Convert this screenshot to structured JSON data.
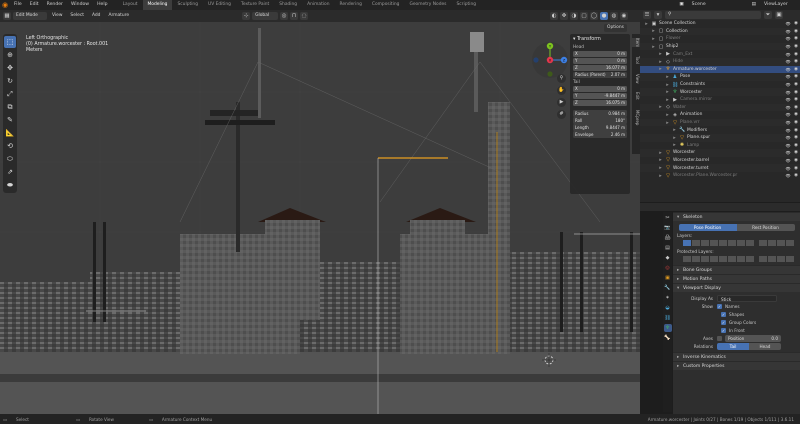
{
  "menubar": {
    "app_logo_icon": "blender-logo-icon",
    "menus": [
      "File",
      "Edit",
      "Render",
      "Window",
      "Help"
    ],
    "workspaces": [
      "Layout",
      "Modeling",
      "Sculpting",
      "UV Editing",
      "Texture Paint",
      "Shading",
      "Animation",
      "Rendering",
      "Compositing",
      "Geometry Nodes",
      "Scripting"
    ],
    "active_workspace": "Modeling",
    "scene_label": "Scene",
    "viewlayer_label": "ViewLayer"
  },
  "viewport_header": {
    "mode": "Edit Mode",
    "menus": [
      "View",
      "Select",
      "Add",
      "Armature"
    ],
    "transform_orientation": "Global",
    "options_label": "Options"
  },
  "viewport_info": {
    "projection": "Left Orthographic",
    "object": "(0) Armature.worcester : Root.001",
    "units": "Meters"
  },
  "npanel": {
    "title": "Transform",
    "head_label": "Head",
    "head": [
      {
        "axis": "X",
        "value": "0 m"
      },
      {
        "axis": "Y",
        "value": "0 m"
      },
      {
        "axis": "Z",
        "value": "16.077 m"
      }
    ],
    "head_radius": {
      "label": "Radius (Parent)",
      "value": "2.07 m"
    },
    "tail_label": "Tail",
    "tail": [
      {
        "axis": "X",
        "value": "0 m"
      },
      {
        "axis": "Y",
        "value": "-9.8447 m"
      },
      {
        "axis": "Z",
        "value": "16.075 m"
      }
    ],
    "props": [
      {
        "label": "Radius",
        "value": "0.984 m"
      },
      {
        "label": "Roll",
        "value": "180°"
      },
      {
        "label": "Length",
        "value": "9.8447 m"
      },
      {
        "label": "Envelope",
        "value": "2.46 m"
      }
    ],
    "tabs": [
      "Item",
      "Tool",
      "View",
      "Edit",
      "MCprep"
    ]
  },
  "gizmo": {
    "x": "X",
    "y": "Y",
    "z": "Z",
    "colors": {
      "x": "#e5374d",
      "y": "#7dc31f",
      "z": "#3d80e5"
    }
  },
  "nav_icons": [
    "zoom-icon",
    "pan-hand-icon",
    "camera-icon",
    "grid-icon"
  ],
  "outliner": {
    "search_placeholder": "",
    "rows": [
      {
        "label": "Scene Collection",
        "indent": 0,
        "icon": "scene-collection-icon",
        "dim": false,
        "sel": false
      },
      {
        "label": "Collection",
        "indent": 1,
        "icon": "collection-icon",
        "dim": false,
        "sel": false
      },
      {
        "label": "Flower",
        "indent": 1,
        "icon": "collection-icon",
        "dim": true,
        "sel": false
      },
      {
        "label": "Ship2",
        "indent": 1,
        "icon": "collection-icon",
        "dim": false,
        "sel": false
      },
      {
        "label": "Cam_Ext",
        "indent": 2,
        "icon": "camera-icon",
        "dim": true,
        "sel": false
      },
      {
        "label": "Hide",
        "indent": 2,
        "icon": "object-icon",
        "dim": true,
        "sel": false
      },
      {
        "label": "Armature.worcester",
        "indent": 2,
        "icon": "armature-icon",
        "dim": false,
        "sel": true
      },
      {
        "label": "Pose",
        "indent": 3,
        "icon": "pose-icon",
        "dim": false,
        "sel": false
      },
      {
        "label": "Constraints",
        "indent": 3,
        "icon": "constraint-icon",
        "dim": false,
        "sel": false
      },
      {
        "label": "Worcester",
        "indent": 3,
        "icon": "armature-data-icon",
        "dim": false,
        "sel": false
      },
      {
        "label": "Camera.mirror",
        "indent": 3,
        "icon": "camera-icon",
        "dim": true,
        "sel": false
      },
      {
        "label": "Water",
        "indent": 2,
        "icon": "object-icon",
        "dim": true,
        "sel": false
      },
      {
        "label": "Animation",
        "indent": 3,
        "icon": "animation-icon",
        "dim": false,
        "sel": false
      },
      {
        "label": "Plane.vrr",
        "indent": 3,
        "icon": "mesh-icon",
        "dim": true,
        "sel": false
      },
      {
        "label": "Modifiers",
        "indent": 4,
        "icon": "wrench-icon",
        "dim": false,
        "sel": false
      },
      {
        "label": "Plane.spur",
        "indent": 4,
        "icon": "mesh-icon",
        "dim": false,
        "sel": false
      },
      {
        "label": "Lamp",
        "indent": 4,
        "icon": "light-icon",
        "dim": true,
        "sel": false
      },
      {
        "label": "Worcester",
        "indent": 2,
        "icon": "mesh-icon",
        "dim": false,
        "sel": false
      },
      {
        "label": "Worcester.barrel",
        "indent": 2,
        "icon": "mesh-icon",
        "dim": false,
        "sel": false
      },
      {
        "label": "Worcester.turret",
        "indent": 2,
        "icon": "mesh-icon",
        "dim": false,
        "sel": false
      },
      {
        "label": "Worcester.Plane.Worcester.pr",
        "indent": 2,
        "icon": "mesh-icon",
        "dim": true,
        "sel": false
      }
    ]
  },
  "properties": {
    "skeleton_title": "Skeleton",
    "pose_position": "Pose Position",
    "rest_position": "Rest Position",
    "layers_label": "Layers:",
    "protected_layers_label": "Protected Layers:",
    "collapsed_sections": [
      "Bone Groups",
      "Motion Paths"
    ],
    "viewport_display_title": "Viewport Display",
    "display_as_label": "Display As",
    "display_as_value": "Stick",
    "show_label": "Show",
    "show_options": [
      "Names",
      "Shapes",
      "Group Colors",
      "In Front"
    ],
    "axes_label": "Axes",
    "position_label": "Position",
    "position_value": "0.0",
    "relations_label": "Relations",
    "relations_options": [
      "Tail",
      "Head"
    ],
    "bottom_sections": [
      "Inverse Kinematics",
      "Custom Properties"
    ],
    "tab_icons": [
      "tool-icon",
      "render-icon",
      "output-icon",
      "view-layer-icon",
      "scene-icon",
      "world-icon",
      "object-icon",
      "modifier-icon",
      "particles-icon",
      "physics-icon",
      "constraints-icon",
      "armature-data-icon",
      "bone-icon"
    ]
  },
  "statusbar": {
    "items": [
      "Select",
      "Rotate View",
      "Armature Context Menu"
    ],
    "stats": "Armature.worcester | Joints 0/27 | Bones 1/19 | Objects 1/111 | 3.6.11"
  }
}
